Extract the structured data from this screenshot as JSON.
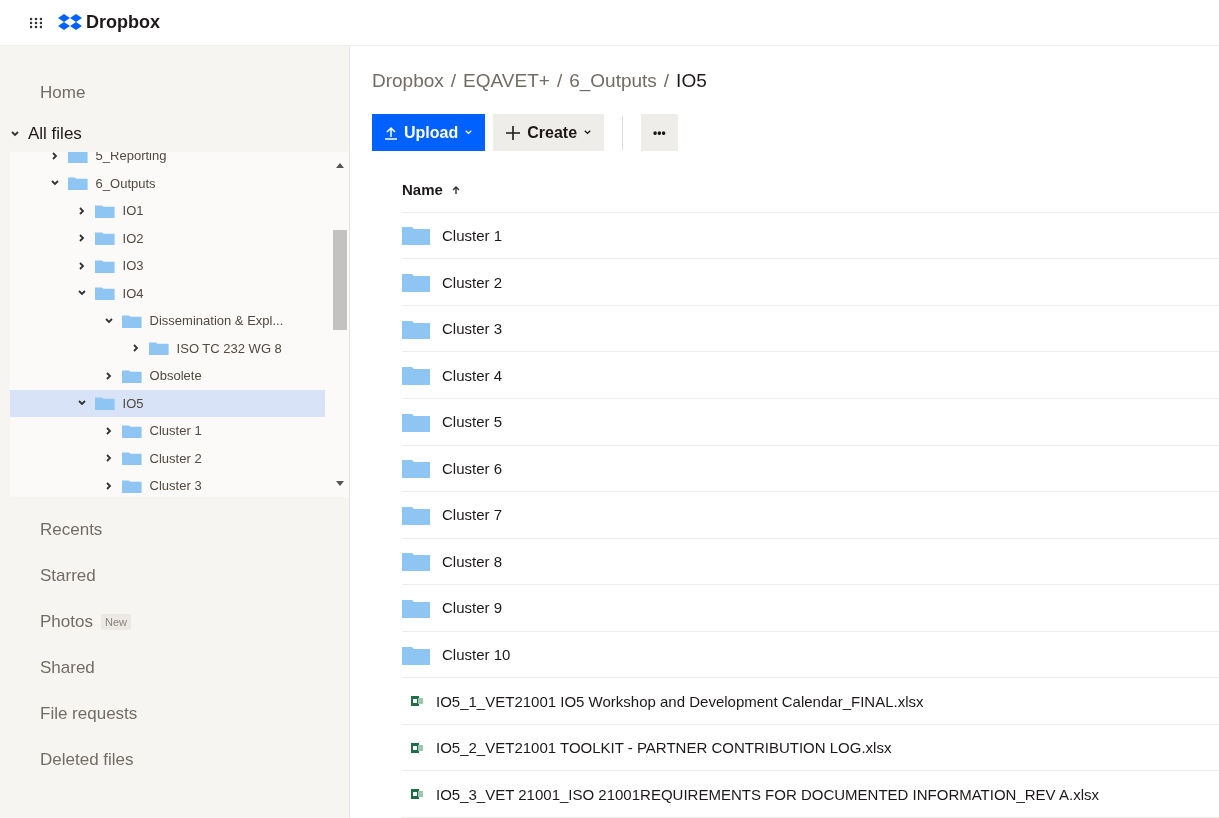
{
  "app": {
    "name": "Dropbox"
  },
  "sidebar": {
    "top_items": [
      {
        "label": "Home",
        "selected": false
      }
    ],
    "all_files": {
      "label": "All files",
      "expanded": true
    },
    "tree": [
      {
        "label": "5_Reporting",
        "expanded": false,
        "selected": false
      },
      {
        "label": "6_Outputs",
        "expanded": true,
        "selected": false,
        "children": [
          {
            "label": "IO1",
            "expanded": false,
            "selected": false
          },
          {
            "label": "IO2",
            "expanded": false,
            "selected": false
          },
          {
            "label": "IO3",
            "expanded": false,
            "selected": false
          },
          {
            "label": "IO4",
            "expanded": true,
            "selected": false,
            "children": [
              {
                "label": "Dissemination & Expl...",
                "expanded": true,
                "selected": false,
                "children": [
                  {
                    "label": "ISO TC 232 WG 8",
                    "expanded": false,
                    "selected": false
                  }
                ]
              },
              {
                "label": "Obsolete",
                "expanded": false,
                "selected": false
              }
            ]
          },
          {
            "label": "IO5",
            "expanded": true,
            "selected": true,
            "children": [
              {
                "label": "Cluster 1",
                "expanded": false,
                "selected": false
              },
              {
                "label": "Cluster 2",
                "expanded": false,
                "selected": false
              },
              {
                "label": "Cluster 3",
                "expanded": false,
                "selected": false
              }
            ]
          }
        ]
      }
    ],
    "bottom_items": [
      {
        "label": "Recents"
      },
      {
        "label": "Starred"
      },
      {
        "label": "Photos",
        "badge": "New"
      },
      {
        "label": "Shared"
      },
      {
        "label": "File requests"
      },
      {
        "label": "Deleted files"
      }
    ]
  },
  "breadcrumb": {
    "separator": "/",
    "items": [
      "Dropbox",
      "EQAVET+",
      "6_Outputs",
      "IO5"
    ]
  },
  "toolbar": {
    "upload": "Upload",
    "create": "Create",
    "more": "•••"
  },
  "table": {
    "columns": [
      {
        "label": "Name",
        "sorted_ascending": true
      }
    ],
    "rows": [
      {
        "kind": "folder",
        "name": "Cluster 1"
      },
      {
        "kind": "folder",
        "name": "Cluster 2"
      },
      {
        "kind": "folder",
        "name": "Cluster 3"
      },
      {
        "kind": "folder",
        "name": "Cluster 4"
      },
      {
        "kind": "folder",
        "name": "Cluster 5"
      },
      {
        "kind": "folder",
        "name": "Cluster 6"
      },
      {
        "kind": "folder",
        "name": "Cluster 7"
      },
      {
        "kind": "folder",
        "name": "Cluster 8"
      },
      {
        "kind": "folder",
        "name": "Cluster 9"
      },
      {
        "kind": "folder",
        "name": "Cluster 10"
      },
      {
        "kind": "spreadsheet",
        "name": "IO5_1_VET21001 IO5 Workshop and Development Calendar_FINAL.xlsx"
      },
      {
        "kind": "spreadsheet",
        "name": "IO5_2_VET21001 TOOLKIT - PARTNER CONTRIBUTION LOG.xlsx"
      },
      {
        "kind": "spreadsheet",
        "name": "IO5_3_VET 21001_ISO 21001REQUIREMENTS FOR DOCUMENTED INFORMATION_REV A.xlsx"
      }
    ]
  }
}
